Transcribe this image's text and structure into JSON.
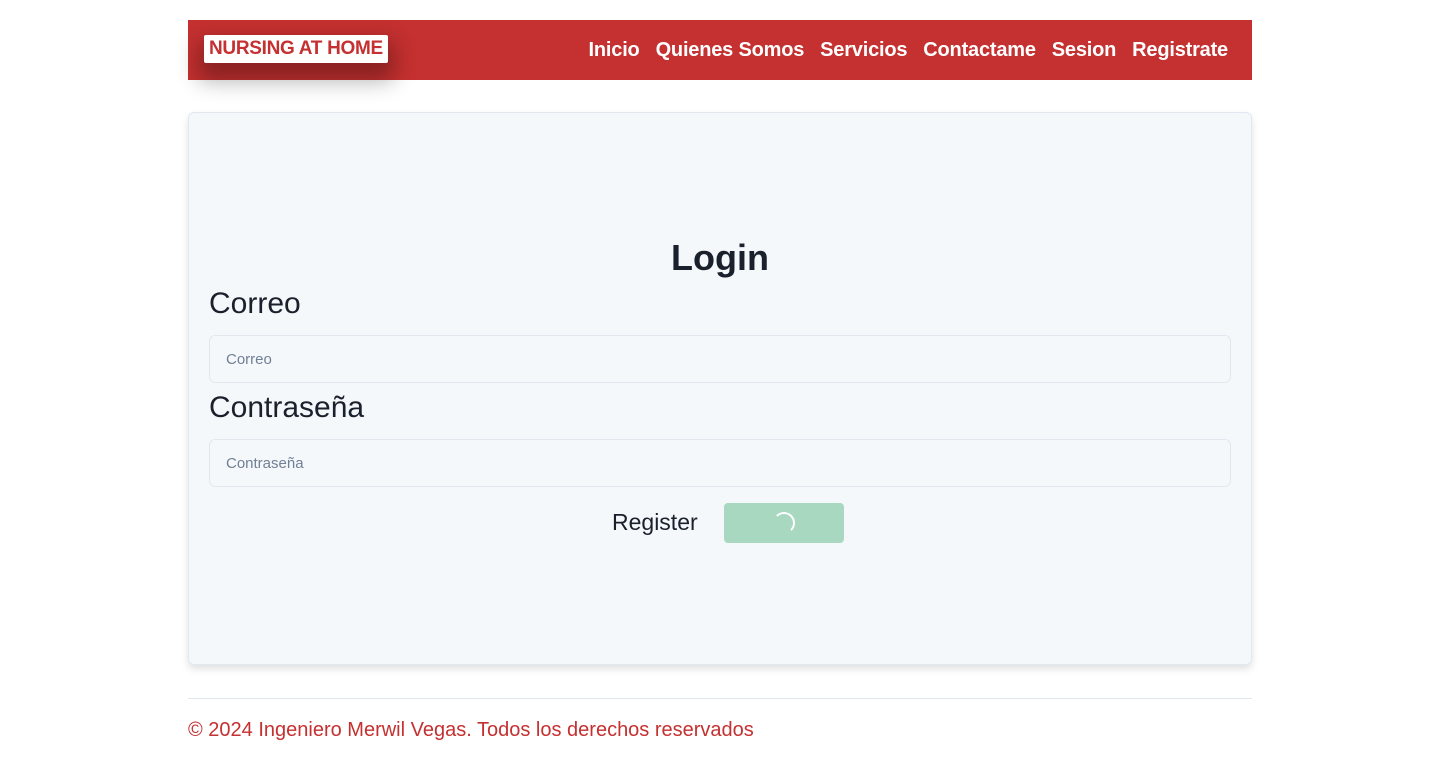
{
  "navbar": {
    "brand": "NURSING AT HOME",
    "links": [
      "Inicio",
      "Quienes Somos",
      "Servicios",
      "Contactame",
      "Sesion",
      "Registrate"
    ]
  },
  "login": {
    "title": "Login",
    "email_label": "Correo",
    "email_placeholder": "Correo",
    "email_value": "",
    "password_label": "Contraseña",
    "password_placeholder": "Contraseña",
    "password_value": "",
    "register_link": "Register",
    "submit_state": "loading"
  },
  "footer": {
    "text": "© 2024 Ingeniero Merwil Vegas. Todos los derechos reservados"
  },
  "colors": {
    "brand_red": "#c53030",
    "card_bg": "#f5f8fb",
    "submit_loading": "#a9d8c0"
  }
}
